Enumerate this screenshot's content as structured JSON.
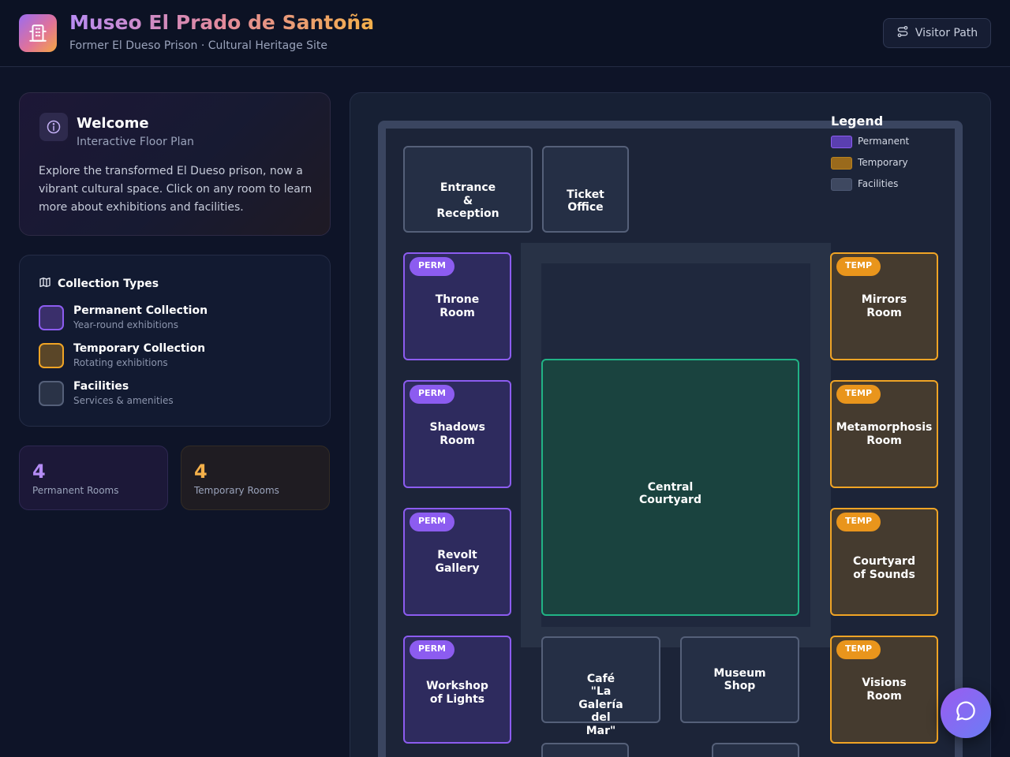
{
  "header": {
    "title": "Museo El Prado de Santoña",
    "subtitle": "Former El Dueso Prison · Cultural Heritage Site",
    "visitor_path_label": "Visitor Path"
  },
  "welcome": {
    "title": "Welcome",
    "subtitle": "Interactive Floor Plan",
    "body": "Explore the transformed El Dueso prison, now a vibrant cultural space. Click on any room to learn more about exhibitions and facilities."
  },
  "collection_types": {
    "title": "Collection Types",
    "items": [
      {
        "label": "Permanent Collection",
        "desc": "Year-round exhibitions"
      },
      {
        "label": "Temporary Collection",
        "desc": "Rotating exhibitions"
      },
      {
        "label": "Facilities",
        "desc": "Services & amenities"
      }
    ]
  },
  "stats": {
    "permanent": {
      "value": "4",
      "label": "Permanent Rooms"
    },
    "temporary": {
      "value": "4",
      "label": "Temporary Rooms"
    }
  },
  "legend": {
    "title": "Legend",
    "items": [
      "Permanent",
      "Temporary",
      "Facilities"
    ]
  },
  "tags": {
    "perm": "PERM",
    "temp": "TEMP"
  },
  "rooms": {
    "entrance": "Entrance & Reception",
    "ticket": "Ticket Office",
    "throne": "Throne Room",
    "shadows": "Shadows Room",
    "revolt": "Revolt Gallery",
    "workshop": "Workshop of Lights",
    "mirrors": "Mirrors Room",
    "metamorphosis": "Metamorphosis Room",
    "sounds": "Courtyard of Sounds",
    "visions": "Visions Room",
    "courtyard": "Central Courtyard",
    "cafe": "Café \"La Galería del Mar\"",
    "shop": "Museum Shop"
  },
  "colors": {
    "permanent": "#8c5cf0",
    "temporary": "#f0a425",
    "facilities": "#556079",
    "courtyard": "#21b385"
  },
  "icons": {
    "logo": "building-icon",
    "visitor_path": "route-icon",
    "welcome": "info-icon",
    "collection_types": "map-icon",
    "chat": "chat-bubble-icon"
  }
}
